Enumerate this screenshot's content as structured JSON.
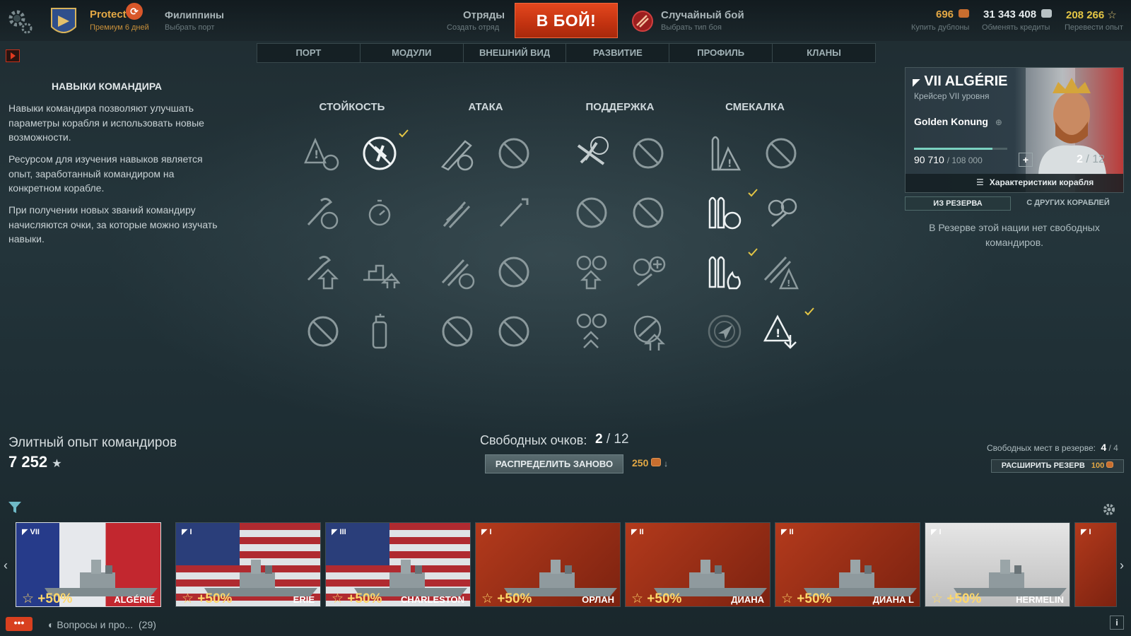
{
  "header": {
    "account_name": "Protect",
    "premium_status": "Премиум 6 дней",
    "port_name": "Филиппины",
    "port_sub": "Выбрать порт",
    "squad_label": "Отряды",
    "squad_sub": "Создать отряд",
    "battle_label": "В БОЙ!",
    "mode_name": "Случайный бой",
    "mode_sub": "Выбрать тип боя",
    "currencies": [
      {
        "value": "696",
        "sub": "Купить дублоны",
        "color": "#e3a845"
      },
      {
        "value": "31 343 408",
        "sub": "Обменять кредиты",
        "color": "#e6ecee"
      },
      {
        "value": "208 266",
        "sub": "Перевести опыт",
        "color": "#e3c545"
      }
    ]
  },
  "nav": {
    "tabs": [
      "ПОРТ",
      "МОДУЛИ",
      "ВНЕШНИЙ ВИД",
      "РАЗВИТИЕ",
      "ПРОФИЛЬ",
      "КЛАНЫ"
    ]
  },
  "info": {
    "title": "НАВЫКИ КОМАНДИРА",
    "p1": "Навыки командира позволяют улучшать параметры корабля и использовать новые возможности.",
    "p2": "Ресурсом для изучения навыков является опыт, заработанный командиром на конкретном корабле.",
    "p3": "При получении новых званий командиру начисляются очки, за которые можно изучать навыки."
  },
  "skills": {
    "columns": [
      "СТОЙКОСТЬ",
      "АТАКА",
      "ПОДДЕРЖКА",
      "СМЕКАЛКА"
    ]
  },
  "points": {
    "label": "Свободных очков:",
    "value": "2",
    "total": "12",
    "redistribute_label": "РАСПРЕДЕЛИТЬ ЗАНОВО",
    "cost": "250"
  },
  "elite": {
    "label": "Элитный опыт командиров",
    "value": "7 252"
  },
  "ship_card": {
    "title": "VII ALGÉRIE",
    "subtitle": "Крейсер VII уровня",
    "commander": "Golden Konung",
    "xp": "90 710",
    "xp_total": "/ 108 000",
    "xp_fraction": 0.84,
    "points": "2",
    "points_total": "12",
    "specs_label": "Характеристики корабля"
  },
  "reserve": {
    "tab_reserve": "ИЗ РЕЗЕРВА",
    "tab_other": "С ДРУГИХ КОРАБЛЕЙ",
    "message": "В Резерве этой нации нет свободных командиров.",
    "slots_label": "Свободных мест в резерве:",
    "slots_value": "4",
    "slots_total": "4",
    "expand_label": "РАСШИРИТЬ РЕЗЕРВ",
    "expand_cost": "100"
  },
  "carousel": {
    "ships": [
      {
        "tier": "VII",
        "name": "ALGÉRIE",
        "bonus": "+50%",
        "flag": "france"
      },
      {
        "tier": "I",
        "name": "ERIE",
        "bonus": "+50%",
        "flag": "usa"
      },
      {
        "tier": "III",
        "name": "CHARLESTON",
        "bonus": "+50%",
        "flag": "usa"
      },
      {
        "tier": "I",
        "name": "ОРЛАН",
        "bonus": "+50%",
        "flag": "ussr"
      },
      {
        "tier": "II",
        "name": "ДИАНА",
        "bonus": "+50%",
        "flag": "ussr"
      },
      {
        "tier": "II",
        "name": "ДИАНА L",
        "bonus": "+50%",
        "flag": "ussr"
      },
      {
        "tier": "I",
        "name": "HERMELIN",
        "bonus": "+50%",
        "flag": "germany"
      },
      {
        "tier": "I",
        "name": "",
        "bonus": "",
        "flag": "ussr"
      }
    ]
  },
  "footer": {
    "questions": "Вопросы и про...",
    "questions_count": "(29)"
  }
}
